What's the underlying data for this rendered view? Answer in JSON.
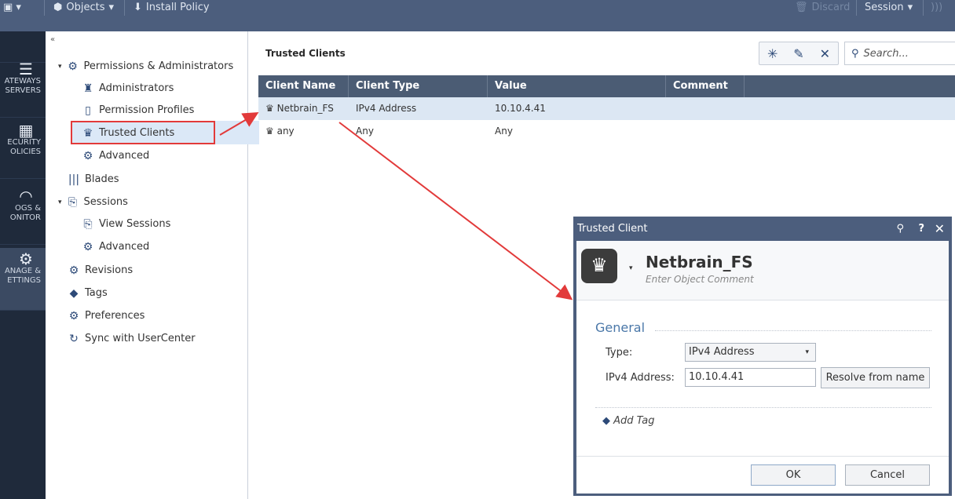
{
  "topbar": {
    "menu_icon": "app-menu-icon",
    "objects": "Objects",
    "install_policy": "Install Policy",
    "discard": "Discard",
    "session": "Session"
  },
  "rail": [
    {
      "label": "ATEWAYS\nSERVERS"
    },
    {
      "label": "ECURITY\nOLICIES"
    },
    {
      "label": "OGS &\nONITOR"
    },
    {
      "label": "ANAGE &\nETTINGS"
    }
  ],
  "tree": {
    "collapse": "«",
    "items": [
      "Permissions & Administrators",
      "Administrators",
      "Permission Profiles",
      "Trusted Clients",
      "Advanced",
      "Blades",
      "Sessions",
      "View Sessions",
      "Advanced",
      "Revisions",
      "Tags",
      "Preferences",
      "Sync with UserCenter"
    ]
  },
  "main": {
    "title": "Trusted Clients",
    "search_placeholder": "Search...",
    "columns": [
      "Client Name",
      "Client Type",
      "Value",
      "Comment"
    ],
    "rows": [
      {
        "name": "Netbrain_FS",
        "type": "IPv4 Address",
        "value": "10.10.4.41",
        "comment": ""
      },
      {
        "name": "any",
        "type": "Any",
        "value": "Any",
        "comment": ""
      }
    ]
  },
  "dialog": {
    "title": "Trusted Client",
    "name": "Netbrain_FS",
    "comment_placeholder": "Enter Object Comment",
    "section": "General",
    "type_label": "Type:",
    "type_value": "IPv4 Address",
    "ip_label": "IPv4 Address:",
    "ip_value": "10.10.4.41",
    "resolve": "Resolve from name",
    "add_tag": "Add Tag",
    "ok": "OK",
    "cancel": "Cancel"
  },
  "colors": {
    "annotation": "#e23a3a",
    "header": "#4c5e7d"
  }
}
